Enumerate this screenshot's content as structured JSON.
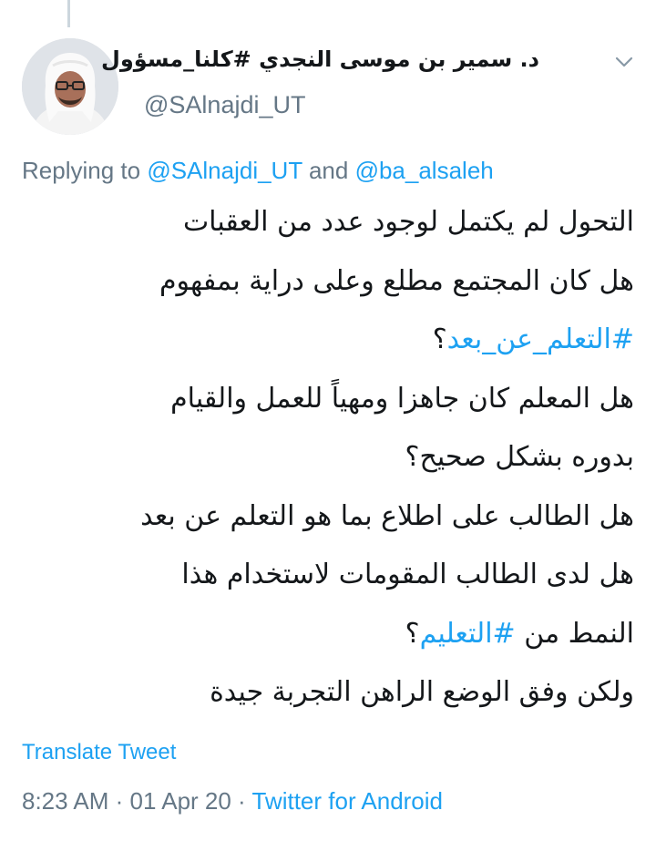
{
  "tweet": {
    "display_name": "د. سمير بن موسى النجدي #كلنا_مسؤول",
    "username": "@SAlnajdi_UT",
    "replying": {
      "prefix": "Replying to ",
      "mention_1": "@SAlnajdi_UT",
      "conjunction": " and ",
      "mention_2": "@ba_alsaleh"
    },
    "body": {
      "line_1": "التحول لم يكتمل لوجود عدد من العقبات",
      "line_2": "هل كان المجتمع مطلع وعلى دراية بمفهوم",
      "line_3_hashtag": "#التعلم_عن_بعد",
      "line_3_suffix": "؟",
      "line_4": "هل المعلم كان جاهزا ومهياً للعمل والقيام",
      "line_5": "بدوره بشكل صحيح؟",
      "line_6": "هل الطالب على اطلاع بما هو التعلم عن بعد",
      "line_7": "هل لدى الطالب المقومات لاستخدام هذا",
      "line_8_prefix": "النمط من ",
      "line_8_hashtag": "#التعليم",
      "line_8_suffix": "؟",
      "line_9": "ولكن وفق الوضع الراهن التجربة جيدة"
    },
    "translate_label": "Translate Tweet",
    "time": "8:23 AM",
    "separator_1": " · ",
    "date": "01 Apr 20",
    "separator_2": " · ",
    "source": "Twitter for Android"
  },
  "icons": {
    "avatar": "profile-photo",
    "menu": "chevron-down-icon"
  },
  "colors": {
    "link": "#1da1f2",
    "secondary_text": "#657786",
    "primary_text": "#14171a",
    "thread_line": "#ccd6dd"
  }
}
